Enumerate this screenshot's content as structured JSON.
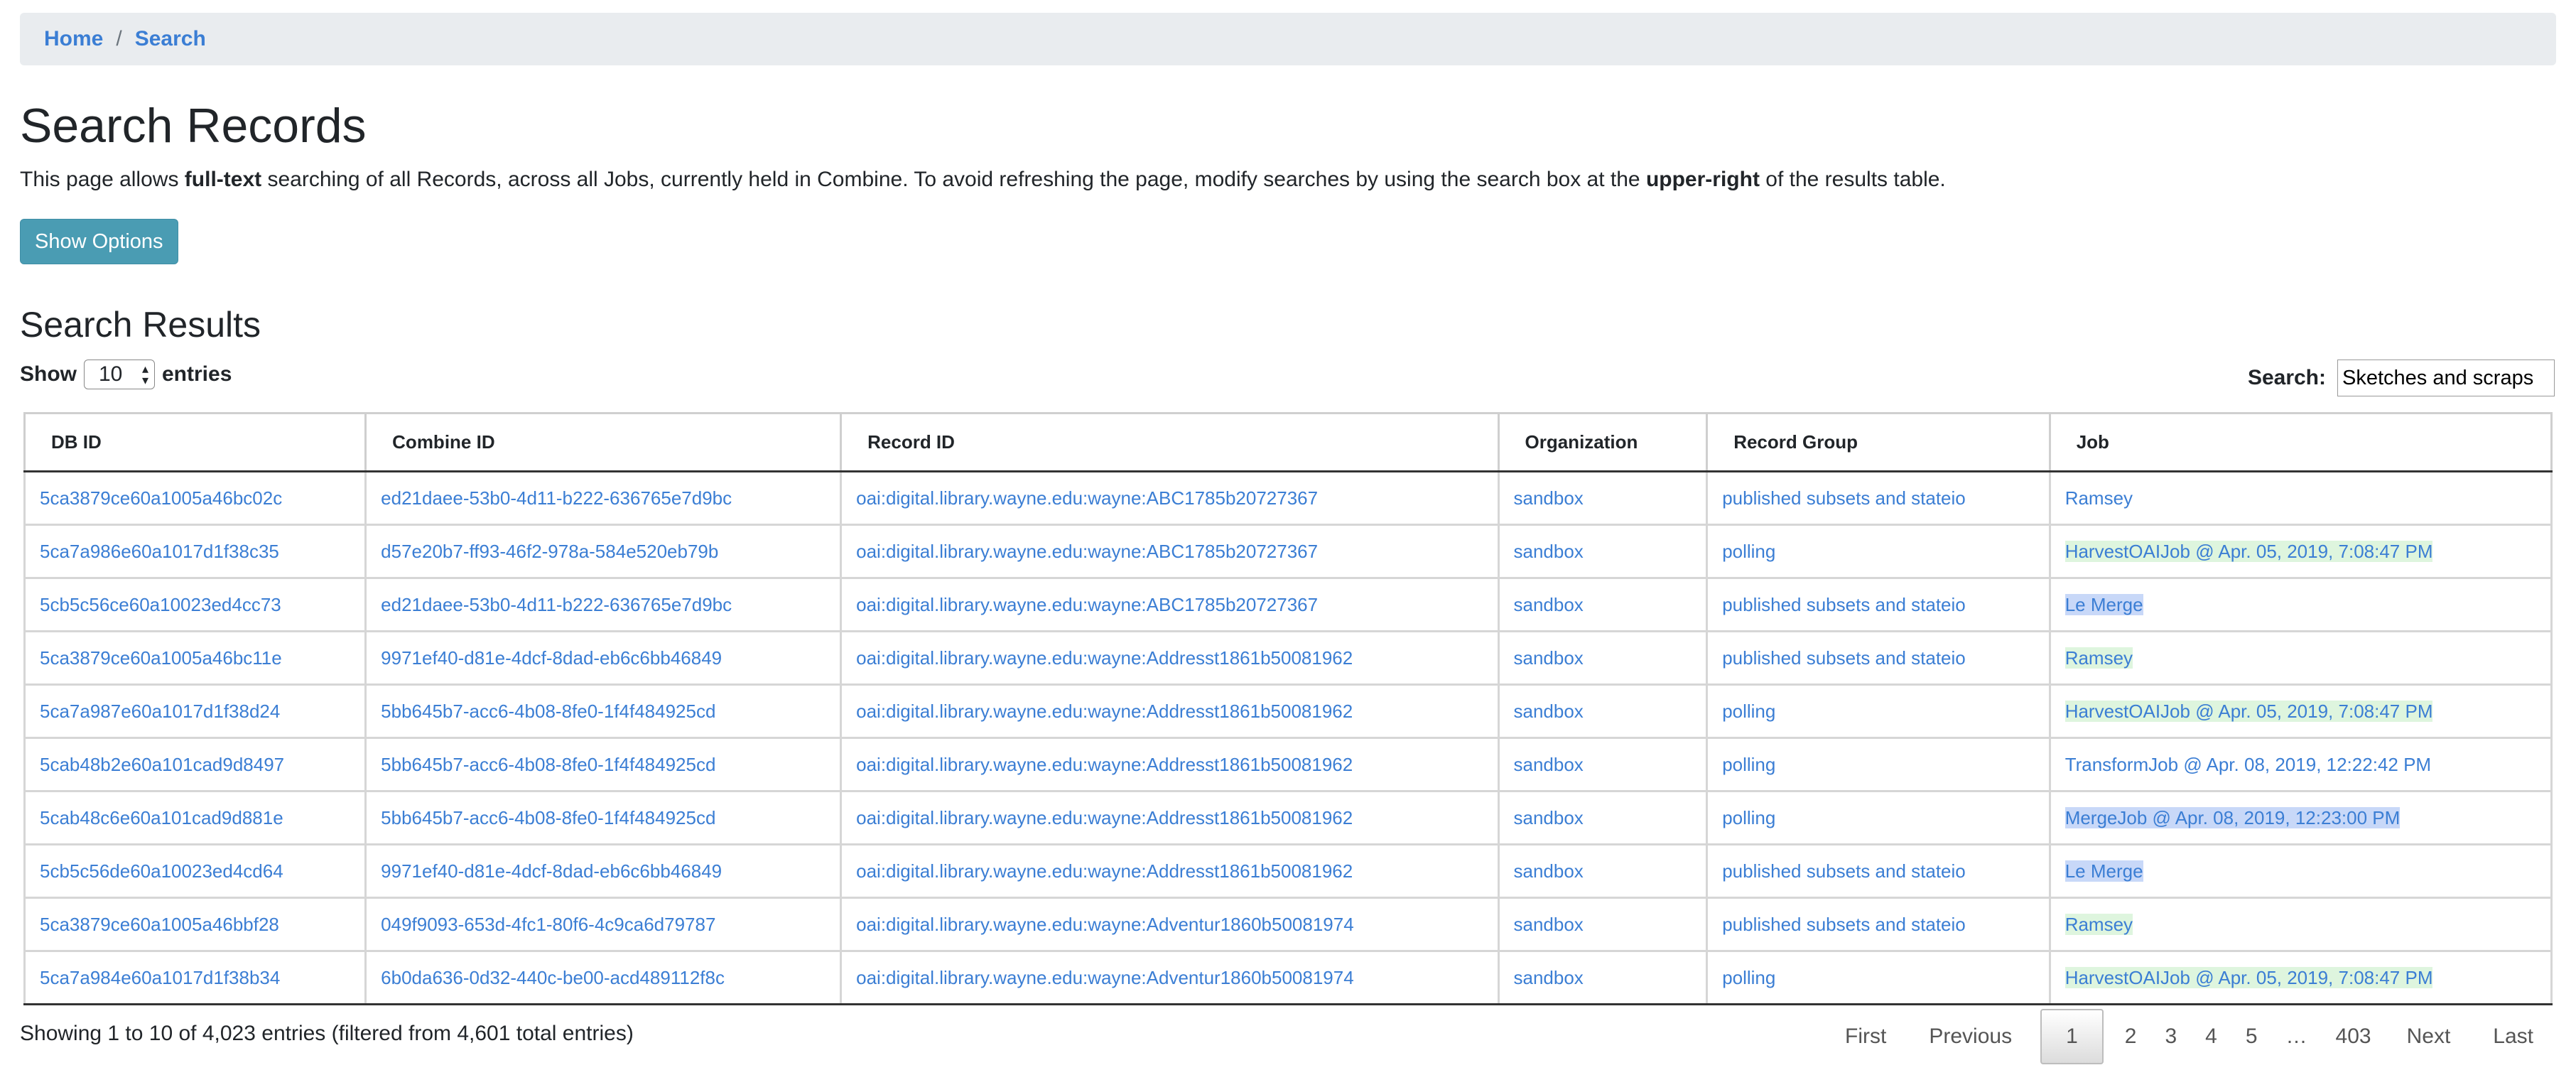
{
  "breadcrumb": {
    "home": "Home",
    "separator": "/",
    "current": "Search"
  },
  "page": {
    "title": "Search Records",
    "intro": {
      "part1": "This page allows ",
      "bold1": "full-text",
      "part2": " searching of all Records, across all Jobs, currently held in Combine. To avoid refreshing the page, modify searches by using the search box at the ",
      "bold2": "upper-right",
      "part3": " of the results table."
    },
    "show_options_label": "Show Options"
  },
  "results": {
    "title": "Search Results",
    "length": {
      "prefix": "Show",
      "value": "10",
      "suffix": "entries"
    },
    "search": {
      "label": "Search:",
      "value": "Sketches and scraps"
    },
    "columns": [
      "DB ID",
      "Combine ID",
      "Record ID",
      "Organization",
      "Record Group",
      "Job"
    ],
    "rows": [
      {
        "db_id": "5ca3879ce60a1005a46bc02c",
        "combine_id": "ed21daee-53b0-4d11-b222-636765e7d9bc",
        "record_id": "oai:digital.library.wayne.edu:wayne:ABC1785b20727367",
        "org": "sandbox",
        "group": "published subsets and stateio",
        "job": "Ramsey",
        "job_hl": "none"
      },
      {
        "db_id": "5ca7a986e60a1017d1f38c35",
        "combine_id": "d57e20b7-ff93-46f2-978a-584e520eb79b",
        "record_id": "oai:digital.library.wayne.edu:wayne:ABC1785b20727367",
        "org": "sandbox",
        "group": "polling",
        "job": "HarvestOAIJob @ Apr. 05, 2019, 7:08:47 PM",
        "job_hl": "green"
      },
      {
        "db_id": "5cb5c56ce60a10023ed4cc73",
        "combine_id": "ed21daee-53b0-4d11-b222-636765e7d9bc",
        "record_id": "oai:digital.library.wayne.edu:wayne:ABC1785b20727367",
        "org": "sandbox",
        "group": "published subsets and stateio",
        "job": "Le Merge",
        "job_hl": "blue"
      },
      {
        "db_id": "5ca3879ce60a1005a46bc11e",
        "combine_id": "9971ef40-d81e-4dcf-8dad-eb6c6bb46849",
        "record_id": "oai:digital.library.wayne.edu:wayne:Addresst1861b50081962",
        "org": "sandbox",
        "group": "published subsets and stateio",
        "job": "Ramsey",
        "job_hl": "green"
      },
      {
        "db_id": "5ca7a987e60a1017d1f38d24",
        "combine_id": "5bb645b7-acc6-4b08-8fe0-1f4f484925cd",
        "record_id": "oai:digital.library.wayne.edu:wayne:Addresst1861b50081962",
        "org": "sandbox",
        "group": "polling",
        "job": "HarvestOAIJob @ Apr. 05, 2019, 7:08:47 PM",
        "job_hl": "green"
      },
      {
        "db_id": "5cab48b2e60a101cad9d8497",
        "combine_id": "5bb645b7-acc6-4b08-8fe0-1f4f484925cd",
        "record_id": "oai:digital.library.wayne.edu:wayne:Addresst1861b50081962",
        "org": "sandbox",
        "group": "polling",
        "job": "TransformJob @ Apr. 08, 2019, 12:22:42 PM",
        "job_hl": "none"
      },
      {
        "db_id": "5cab48c6e60a101cad9d881e",
        "combine_id": "5bb645b7-acc6-4b08-8fe0-1f4f484925cd",
        "record_id": "oai:digital.library.wayne.edu:wayne:Addresst1861b50081962",
        "org": "sandbox",
        "group": "polling",
        "job": "MergeJob @ Apr. 08, 2019, 12:23:00 PM",
        "job_hl": "blue"
      },
      {
        "db_id": "5cb5c56de60a10023ed4cd64",
        "combine_id": "9971ef40-d81e-4dcf-8dad-eb6c6bb46849",
        "record_id": "oai:digital.library.wayne.edu:wayne:Addresst1861b50081962",
        "org": "sandbox",
        "group": "published subsets and stateio",
        "job": "Le Merge",
        "job_hl": "blue"
      },
      {
        "db_id": "5ca3879ce60a1005a46bbf28",
        "combine_id": "049f9093-653d-4fc1-80f6-4c9ca6d79787",
        "record_id": "oai:digital.library.wayne.edu:wayne:Adventur1860b50081974",
        "org": "sandbox",
        "group": "published subsets and stateio",
        "job": "Ramsey",
        "job_hl": "green"
      },
      {
        "db_id": "5ca7a984e60a1017d1f38b34",
        "combine_id": "6b0da636-0d32-440c-be00-acd489112f8c",
        "record_id": "oai:digital.library.wayne.edu:wayne:Adventur1860b50081974",
        "org": "sandbox",
        "group": "polling",
        "job": "HarvestOAIJob @ Apr. 05, 2019, 7:08:47 PM",
        "job_hl": "green"
      }
    ],
    "info": "Showing 1 to 10 of 4,023 entries (filtered from 4,601 total entries)",
    "pager": {
      "first": "First",
      "previous": "Previous",
      "pages": [
        "1",
        "2",
        "3",
        "4",
        "5"
      ],
      "current": "1",
      "ellipsis": "…",
      "last_page": "403",
      "next": "Next",
      "last": "Last"
    }
  },
  "colors": {
    "link": "#3b7ed4",
    "button": "#4a9cb3",
    "highlight_green": "#def5de",
    "highlight_blue": "#c8d8f8"
  }
}
